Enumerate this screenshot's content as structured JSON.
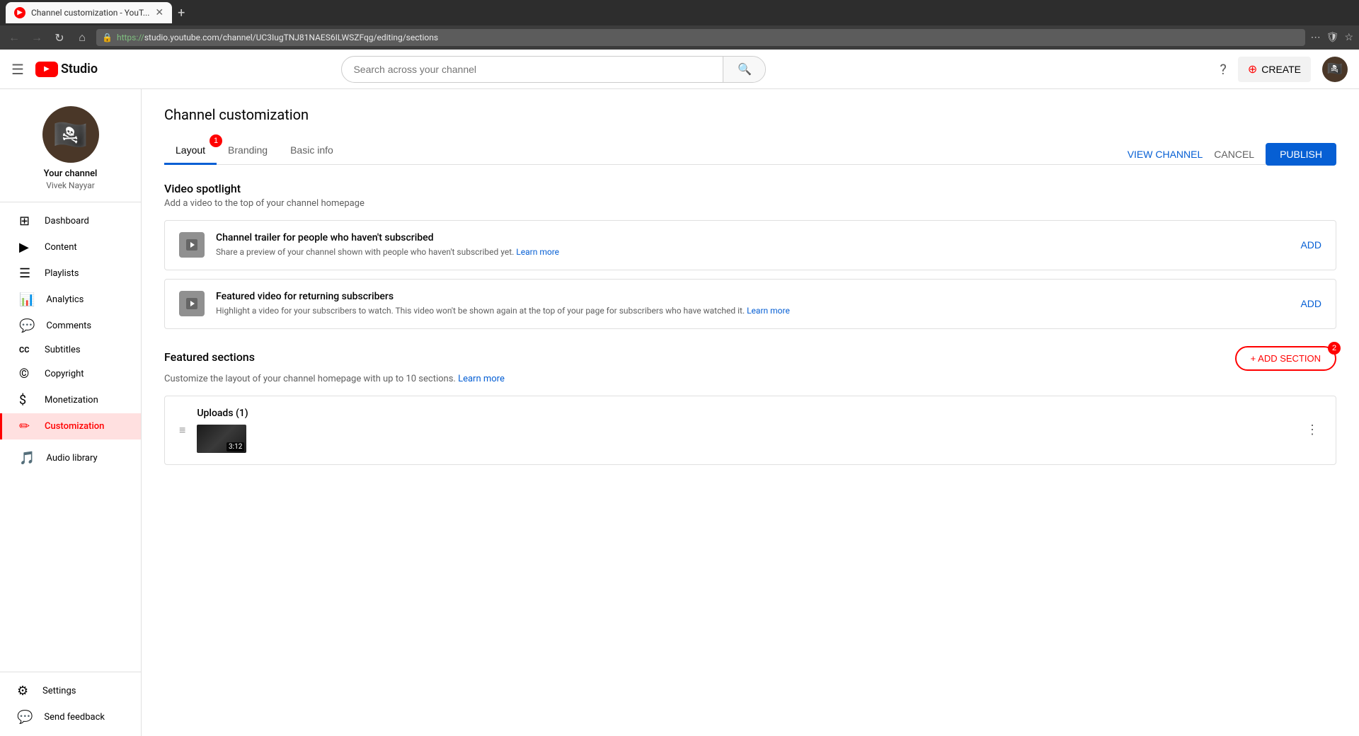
{
  "browser": {
    "tab_title": "Channel customization - YouT...",
    "url_full": "https://studio.youtube.com/channel/UC3IugTNJ81NAES6ILWSZFqg/editing/sections",
    "url_https": "https://",
    "url_rest": "studio.youtube.com/channel/UC3IugTNJ81NAES6ILWSZFqg/editing/sections"
  },
  "header": {
    "search_placeholder": "Search across your channel",
    "create_label": "CREATE",
    "logo_text": "Studio"
  },
  "sidebar": {
    "channel_name": "Your channel",
    "channel_username": "Vivek Nayyar",
    "nav_items": [
      {
        "id": "dashboard",
        "label": "Dashboard",
        "icon": "⊞"
      },
      {
        "id": "content",
        "label": "Content",
        "icon": "▶"
      },
      {
        "id": "playlists",
        "label": "Playlists",
        "icon": "☰"
      },
      {
        "id": "analytics",
        "label": "Analytics",
        "icon": "📊"
      },
      {
        "id": "comments",
        "label": "Comments",
        "icon": "💬"
      },
      {
        "id": "subtitles",
        "label": "Subtitles",
        "icon": "CC"
      },
      {
        "id": "copyright",
        "label": "Copyright",
        "icon": "©"
      },
      {
        "id": "monetization",
        "label": "Monetization",
        "icon": "$"
      },
      {
        "id": "customization",
        "label": "Customization",
        "icon": "✏",
        "active": true
      }
    ],
    "bottom_items": [
      {
        "id": "audio-library",
        "label": "Audio library",
        "icon": "🎵"
      },
      {
        "id": "settings",
        "label": "Settings",
        "icon": "⚙"
      },
      {
        "id": "send-feedback",
        "label": "Send feedback",
        "icon": "?"
      }
    ]
  },
  "page": {
    "title": "Channel customization",
    "tabs": [
      {
        "id": "layout",
        "label": "Layout",
        "active": true,
        "badge": "1"
      },
      {
        "id": "branding",
        "label": "Branding",
        "active": false
      },
      {
        "id": "basic-info",
        "label": "Basic info",
        "active": false
      }
    ],
    "actions": {
      "view_channel": "VIEW CHANNEL",
      "cancel": "CANCEL",
      "publish": "PUBLISH"
    }
  },
  "video_spotlight": {
    "section_title": "Video spotlight",
    "section_desc": "Add a video to the top of your channel homepage",
    "cards": [
      {
        "id": "channel-trailer",
        "title": "Channel trailer for people who haven't subscribed",
        "desc": "Share a preview of your channel shown with people who haven't subscribed yet.",
        "learn_more": "Learn more",
        "action": "ADD"
      },
      {
        "id": "featured-video",
        "title": "Featured video for returning subscribers",
        "desc": "Highlight a video for your subscribers to watch. This video won't be shown again at the top of your page for subscribers who have watched it.",
        "learn_more": "Learn more",
        "action": "ADD"
      }
    ]
  },
  "featured_sections": {
    "section_title": "Featured sections",
    "section_desc": "Customize the layout of your channel homepage with up to 10 sections.",
    "learn_more": "Learn more",
    "add_section_label": "+ ADD SECTION",
    "add_section_badge": "2",
    "uploads": {
      "title": "Uploads (1)",
      "duration": "3:12"
    }
  }
}
